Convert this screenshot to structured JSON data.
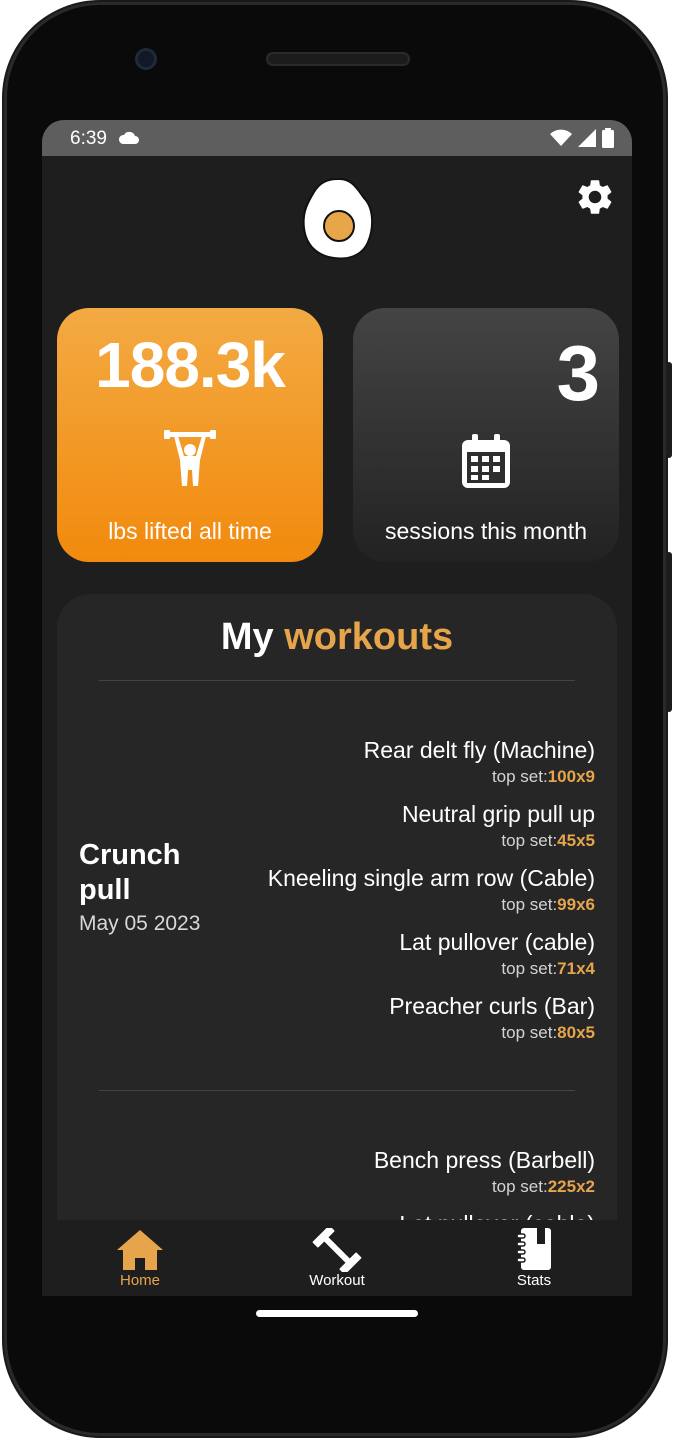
{
  "status_bar": {
    "time": "6:39"
  },
  "stats": {
    "lifted_value": "188.3k",
    "lifted_label": "lbs lifted all time",
    "sessions_value": "3",
    "sessions_label": "sessions this month"
  },
  "workouts": {
    "title_prefix": "My",
    "title_accent": "workouts",
    "items": [
      {
        "name_line1": "Crunch",
        "name_line2": "pull",
        "date": "May 05 2023",
        "exercises": [
          {
            "name": "Rear delt fly (Machine)",
            "top_label": "top set:",
            "top_value": "100x9"
          },
          {
            "name": "Neutral grip pull up",
            "top_label": "top set:",
            "top_value": "45x5"
          },
          {
            "name": "Kneeling single arm row (Cable)",
            "top_label": "top set:",
            "top_value": "99x6"
          },
          {
            "name": "Lat pullover (cable)",
            "top_label": "top set:",
            "top_value": "71x4"
          },
          {
            "name": "Preacher curls (Bar)",
            "top_label": "top set:",
            "top_value": "80x5"
          }
        ]
      },
      {
        "exercises": [
          {
            "name": "Bench press (Barbell)",
            "top_label": "top set:",
            "top_value": "225x2"
          },
          {
            "name": "Lat pullover (cable)"
          }
        ]
      }
    ]
  },
  "nav": {
    "home": "Home",
    "workout": "Workout",
    "stats": "Stats"
  },
  "colors": {
    "accent": "#e7a54b",
    "orange_card": "#f28a0d",
    "background": "#1e1e1e"
  },
  "icons": [
    "cloud-icon",
    "wifi-icon",
    "signal-icon",
    "battery-icon",
    "egg-logo",
    "gear-icon",
    "weightlifter-icon",
    "calendar-icon",
    "home-icon",
    "dumbbell-icon",
    "notebook-icon"
  ]
}
